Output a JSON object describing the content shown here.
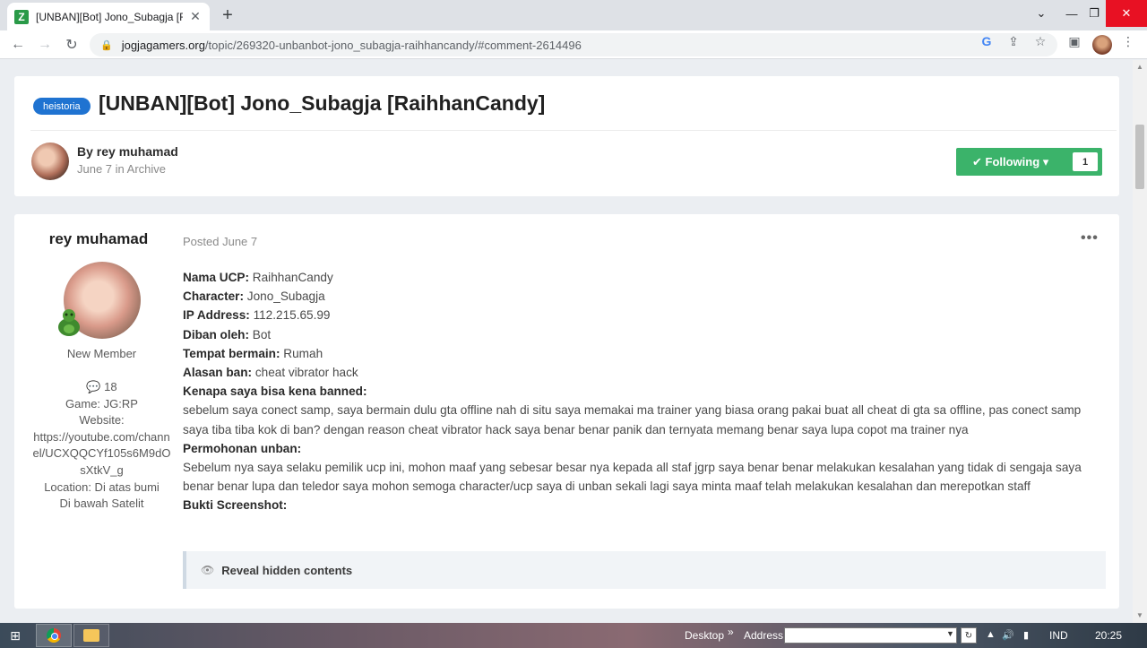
{
  "browser": {
    "tab_title": "[UNBAN][Bot] Jono_Subagja [RaihhanCandy] - Archive - JGRP Forum",
    "new_tab_symbol": "+",
    "url_host": "jogjagamers.org",
    "url_path": "/topic/269320-unbanbot-jono_subagja-raihhancandy/#comment-2614496",
    "icons": [
      "back-icon",
      "forward-icon",
      "reload-icon",
      "lock-icon",
      "google-icon",
      "share-icon",
      "star-icon",
      "sidebar-icon",
      "menu-icon"
    ]
  },
  "topic": {
    "tag": "heistoria",
    "title": "[UNBAN][Bot] Jono_Subagja [RaihhanCandy]",
    "by_line": "By rey muhamad",
    "date_line": "June 7 in Archive",
    "follow_label": "✔ Following ▾",
    "follow_count": "1"
  },
  "post": {
    "author": "rey muhamad",
    "member_group": "New Member",
    "posts_count": "💬 18",
    "game": "Game: JG:RP",
    "website_label": "Website:",
    "website": "https://youtube.com/channel/UCXQQCYf105s6M9dOsXtkV_g",
    "location_line1": "Location: Di atas bumi",
    "location_line2": "Di bawah Satelit",
    "posted": "Posted June 7",
    "menu": "•••",
    "fields": {
      "ucp_label": "Nama UCP:",
      "ucp_value": " RaihhanCandy",
      "char_label": "Character:",
      "char_value": " Jono_Subagja",
      "ip_label": "IP Address:",
      "ip_value": " 112.215.65.99",
      "banned_by_label": "Diban oleh:",
      "banned_by_value": " Bot",
      "place_label": "Tempat bermain:",
      "place_value": " Rumah",
      "reason_label": "Alasan ban:",
      "reason_value": " cheat vibrator hack",
      "why_label": "Kenapa saya bisa kena banned:",
      "why_text": "sebelum saya conect samp, saya bermain dulu gta offline nah di situ saya memakai ma trainer yang biasa orang pakai buat all cheat di gta sa offline, pas conect samp saya tiba tiba kok di ban? dengan reason cheat vibrator hack saya benar benar panik dan ternyata memang benar saya lupa copot ma trainer nya",
      "appeal_label": "Permohonan unban:",
      "appeal_text": "Sebelum nya saya selaku pemilik ucp ini, mohon maaf yang sebesar besar nya kepada all staf jgrp saya benar benar melakukan kesalahan yang tidak di sengaja saya benar benar lupa dan teledor saya mohon semoga character/ucp saya di unban sekali lagi saya minta maaf telah melakukan kesalahan dan merepotkan staff",
      "screenshot_label": "Bukti Screenshot:"
    },
    "reveal_label": "Reveal hidden contents"
  },
  "taskbar": {
    "desktop": "Desktop",
    "chevrons": "»",
    "address": "Address",
    "lang": "IND",
    "time": "20:25"
  }
}
